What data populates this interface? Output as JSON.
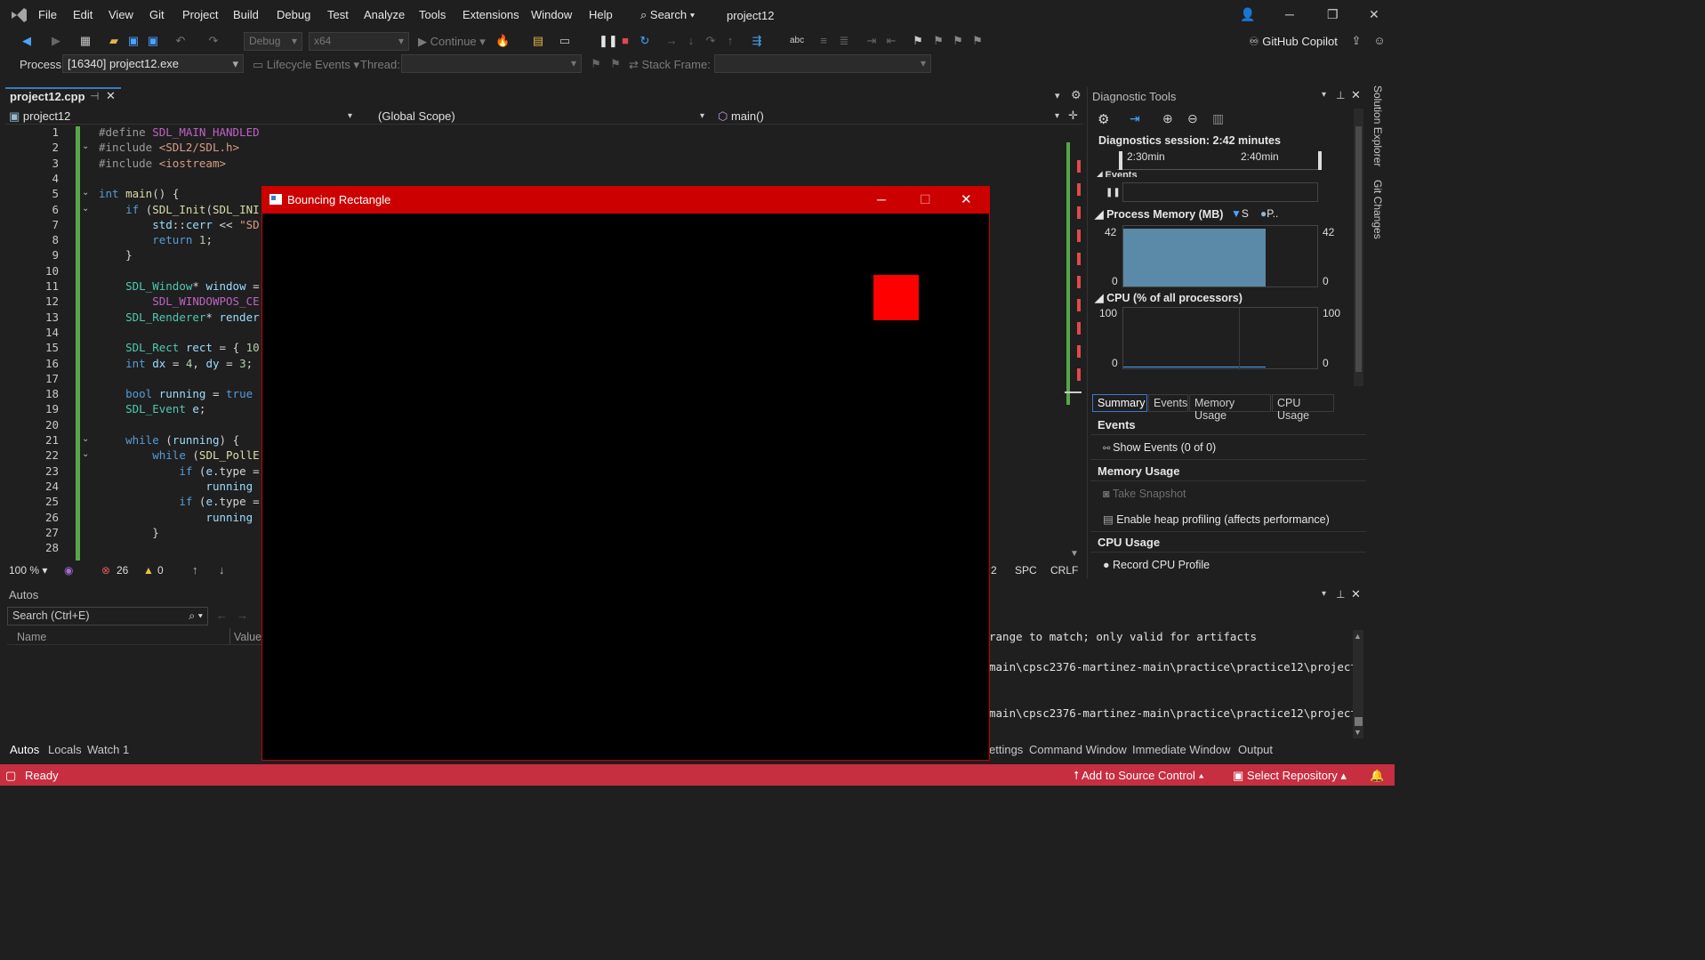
{
  "menu": {
    "items": [
      "File",
      "Edit",
      "View",
      "Git",
      "Project",
      "Build",
      "Debug",
      "Test",
      "Analyze",
      "Tools",
      "Extensions",
      "Window",
      "Help"
    ],
    "search_label": "Search",
    "project_title": "project12"
  },
  "toolbar": {
    "config": "Debug",
    "platform": "x64",
    "continue_label": "Continue",
    "copilot_label": "GitHub Copilot"
  },
  "toolbar2": {
    "process_label": "Process:",
    "process_value": "[16340] project12.exe",
    "lifecycle_label": "Lifecycle Events",
    "thread_label": "Thread:",
    "stackframe_label": "Stack Frame:"
  },
  "editor": {
    "tab_label": "project12.cpp",
    "nav_project": "project12",
    "nav_scope": "(Global Scope)",
    "nav_function": "main()",
    "lines": [
      {
        "n": "1",
        "t": "#define SDL_MAIN_HANDLED"
      },
      {
        "n": "2",
        "t": "#include <SDL2/SDL.h>"
      },
      {
        "n": "3",
        "t": "#include <iostream>"
      },
      {
        "n": "4",
        "t": ""
      },
      {
        "n": "5",
        "t": "int main() {"
      },
      {
        "n": "6",
        "t": "    if (SDL_Init(SDL_INI"
      },
      {
        "n": "7",
        "t": "        std::cerr << \"SD"
      },
      {
        "n": "8",
        "t": "        return 1;"
      },
      {
        "n": "9",
        "t": "    }"
      },
      {
        "n": "10",
        "t": ""
      },
      {
        "n": "11",
        "t": "    SDL_Window* window ="
      },
      {
        "n": "12",
        "t": "        SDL_WINDOWPOS_CE"
      },
      {
        "n": "13",
        "t": "    SDL_Renderer* render"
      },
      {
        "n": "14",
        "t": ""
      },
      {
        "n": "15",
        "t": "    SDL_Rect rect = { 10"
      },
      {
        "n": "16",
        "t": "    int dx = 4, dy = 3;"
      },
      {
        "n": "17",
        "t": ""
      },
      {
        "n": "18",
        "t": "    bool running = true"
      },
      {
        "n": "19",
        "t": "    SDL_Event e;"
      },
      {
        "n": "20",
        "t": ""
      },
      {
        "n": "21",
        "t": "    while (running) {"
      },
      {
        "n": "22",
        "t": "        while (SDL_PollE"
      },
      {
        "n": "23",
        "t": "            if (e.type ="
      },
      {
        "n": "24",
        "t": "                running"
      },
      {
        "n": "25",
        "t": "            if (e.type ="
      },
      {
        "n": "26",
        "t": "                running"
      },
      {
        "n": "27",
        "t": "        }"
      },
      {
        "n": "28",
        "t": ""
      }
    ],
    "zoom": "100 %",
    "errors": "26",
    "warnings": "0",
    "col": "2",
    "indent": "SPC",
    "eol": "CRLF"
  },
  "diagnostics": {
    "title": "Diagnostic Tools",
    "session": "Diagnostics session: 2:42 minutes",
    "time1": "2:30min",
    "time2": "2:40min",
    "events_label": "Events",
    "mem_label": "Process Memory (MB)",
    "mem_legend1": "S",
    "mem_legend2": "P..",
    "mem_max": "42",
    "mem_min": "0",
    "cpu_label": "CPU (% of all processors)",
    "cpu_max": "100",
    "cpu_min": "0",
    "memory_fill": 0.95,
    "tabs": [
      "Summary",
      "Events",
      "Memory Usage",
      "CPU Usage"
    ],
    "sec_events": "Events",
    "show_events": "Show Events (0 of 0)",
    "sec_memory": "Memory Usage",
    "take_snapshot": "Take Snapshot",
    "heap_profiling": "Enable heap profiling (affects performance)",
    "sec_cpu": "CPU Usage",
    "record_cpu": "Record CPU Profile"
  },
  "side_rail": {
    "solution_explorer": "Solution Explorer",
    "git_changes": "Git Changes"
  },
  "autos": {
    "title": "Autos",
    "search_placeholder": "Search (Ctrl+E)",
    "col_name": "Name",
    "col_value": "Value",
    "tabs": [
      "Autos",
      "Locals",
      "Watch 1"
    ]
  },
  "output": {
    "lines": [
      "range to match; only valid for artifacts",
      "main\\cpsc2376-martinez-main\\practice\\practice12\\project",
      "main\\cpsc2376-martinez-main\\practice\\practice12\\project"
    ],
    "tabs": [
      "ettings",
      "Command Window",
      "Immediate Window",
      "Output"
    ]
  },
  "app_window": {
    "title": "Bouncing Rectangle"
  },
  "statusbar": {
    "ready": "Ready",
    "add_source": "Add to Source Control",
    "select_repo": "Select Repository"
  },
  "colors": {
    "accent": "#3a7ac5",
    "statusbar": "#c72e3f",
    "app_title": "#cc0000",
    "rect": "#ff0000"
  }
}
